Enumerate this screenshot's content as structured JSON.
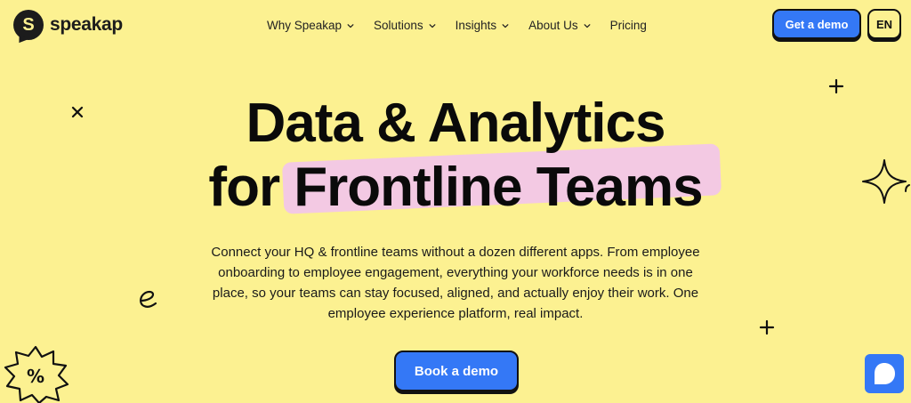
{
  "brand": {
    "name": "speakap",
    "mark": "S"
  },
  "nav": {
    "items": [
      {
        "label": "Why Speakap",
        "has_dropdown": true
      },
      {
        "label": "Solutions",
        "has_dropdown": true
      },
      {
        "label": "Insights",
        "has_dropdown": true
      },
      {
        "label": "About Us",
        "has_dropdown": true
      },
      {
        "label": "Pricing",
        "has_dropdown": false
      }
    ]
  },
  "header": {
    "demo_button": "Get a demo",
    "language": "EN"
  },
  "hero": {
    "title_line1": "Data & Analytics",
    "title_line2": "for Frontline Teams",
    "description": "Connect your HQ & frontline teams without a dozen different apps. From employee onboarding to employee engagement, everything your workforce needs is in one place, so your teams can stay focused, aligned, and actually enjoy their work. One employee experience platform, real impact.",
    "cta": "Book a demo"
  },
  "decorations": {
    "badge_symbol": "%",
    "letter": "e"
  },
  "colors": {
    "background": "#fcf191",
    "accent_blue": "#3478f6",
    "highlight_pink": "#f2c6e8",
    "ink": "#111111"
  },
  "icons": [
    "chevron-down-icon",
    "plus-icon",
    "close-icon",
    "sparkle-icon",
    "percent-badge-icon",
    "chat-icon"
  ]
}
